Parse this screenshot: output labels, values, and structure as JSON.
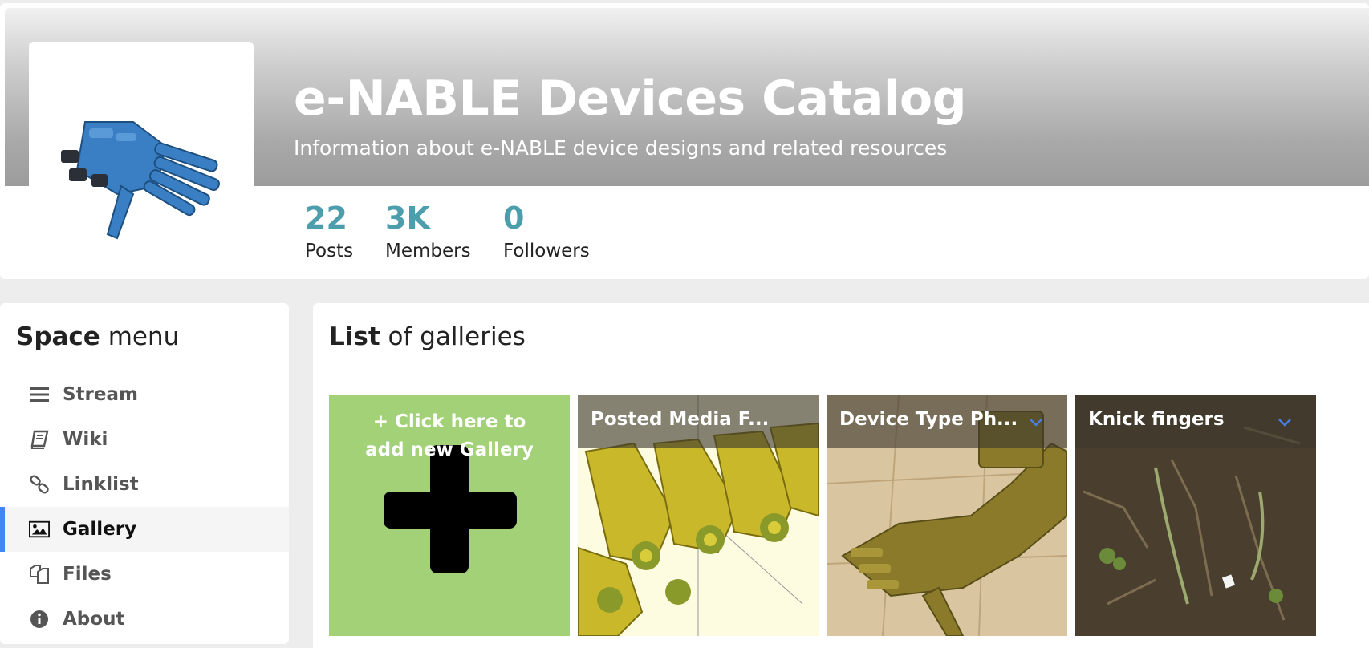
{
  "space": {
    "title": "e-NABLE Devices Catalog",
    "subtitle": "Information about e-NABLE device designs and related resources"
  },
  "stats": [
    {
      "value": "22",
      "label": "Posts"
    },
    {
      "value": "3K",
      "label": "Members"
    },
    {
      "value": "0",
      "label": "Followers"
    }
  ],
  "sidebar": {
    "title_bold": "Space",
    "title_rest": " menu",
    "items": [
      {
        "label": "Stream",
        "icon": "list-icon"
      },
      {
        "label": "Wiki",
        "icon": "book-icon"
      },
      {
        "label": "Linklist",
        "icon": "link-icon"
      },
      {
        "label": "Gallery",
        "icon": "image-icon",
        "active": true
      },
      {
        "label": "Files",
        "icon": "files-icon"
      },
      {
        "label": "About",
        "icon": "info-icon"
      }
    ]
  },
  "main": {
    "title_bold": "List",
    "title_rest": " of galleries",
    "add_tile": {
      "line1": "+ Click here to",
      "line2": "add new Gallery"
    },
    "galleries": [
      {
        "title": "Posted Media F..."
      },
      {
        "title": "Device Type Ph..."
      },
      {
        "title": "Knick fingers"
      }
    ]
  },
  "colors": {
    "accent": "#4d9ead",
    "active_bar": "#4285f4",
    "add_tile": "#a3d178"
  }
}
